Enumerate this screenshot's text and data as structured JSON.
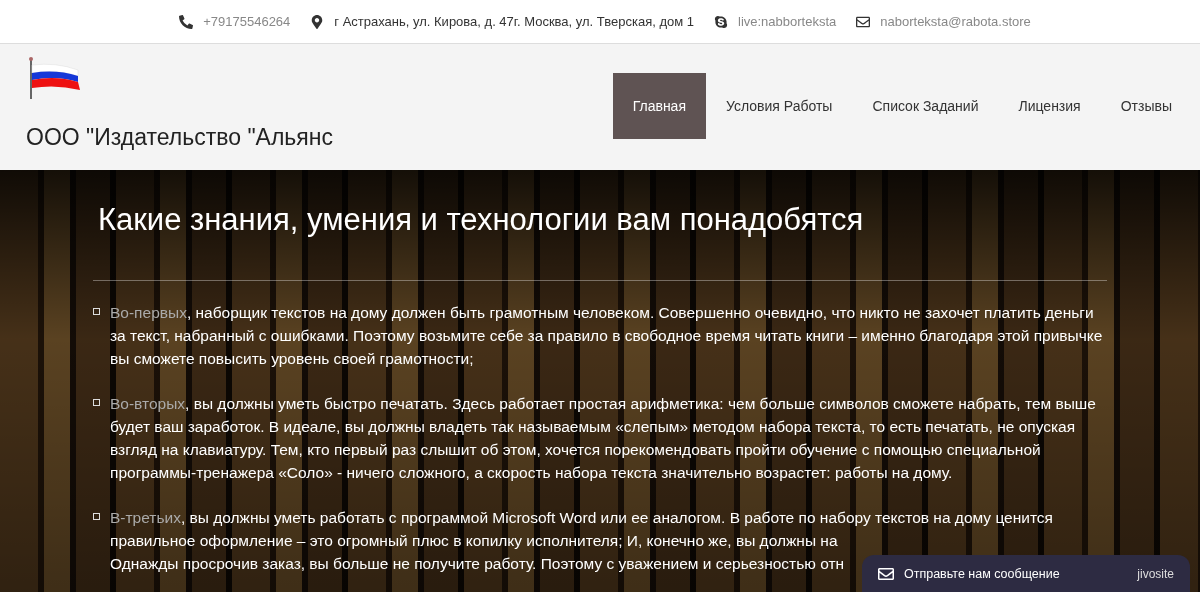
{
  "topbar": {
    "contacts": [
      {
        "kind": "phone",
        "text": "+79175546264"
      },
      {
        "kind": "address",
        "text": "г Астрахань, ул. Кирова, д. 47г. Москва, ул. Тверская, дом 1"
      },
      {
        "kind": "skype",
        "text": "live:nabborteksta"
      },
      {
        "kind": "email",
        "text": "naborteksta@rabota.store"
      }
    ]
  },
  "header": {
    "company": "ООО \"Издательство \"Альянс",
    "nav": [
      {
        "label": "Главная",
        "selected": true
      },
      {
        "label": "Условия Работы",
        "selected": false
      },
      {
        "label": "Список Заданий",
        "selected": false
      },
      {
        "label": "Лицензия",
        "selected": false
      },
      {
        "label": "Отзывы",
        "selected": false
      }
    ]
  },
  "article": {
    "title": "Какие знания, умения и технологии вам понадобятся",
    "items": [
      {
        "lead": "Во-первых",
        "text": ", наборщик текстов на дому должен быть грамотным человеком. Совершенно очевидно, что никто не захочет платить деньги за текст, набранный с ошибками. Поэтому возьмите себе за правило в свободное время читать книги – именно благодаря этой привычке вы сможете повысить уровень своей грамотности;"
      },
      {
        "lead": "Во-вторых",
        "text": ", вы должны уметь быстро печатать. Здесь работает простая арифметика: чем больше символов сможете набрать, тем выше будет ваш заработок. В идеале, вы должны владеть так называемым «слепым» методом набора текста, то есть печатать, не опуская взгляд на клавиатуру. Тем, кто первый раз слышит об этом, хочется порекомендовать пройти обучение с помощью специальной программы-тренажера «Соло» - ничего сложного, а скорость набора текста значительно возрастет: работы на дому."
      },
      {
        "lead": "В-третьих",
        "text": ", вы должны уметь работать с программой Microsoft Word или ее аналогом. В работе по набору текстов на дому ценится правильное оформление – это огромный плюс в копилку исполнителя; И, конечно же, вы должны на",
        "continuation": "Однажды просрочив заказ, вы больше не получите работу. Поэтому с уважением и серьезностью отн"
      }
    ]
  },
  "chat": {
    "label": "Отправьте нам сообщение",
    "brand": "jivosite"
  }
}
